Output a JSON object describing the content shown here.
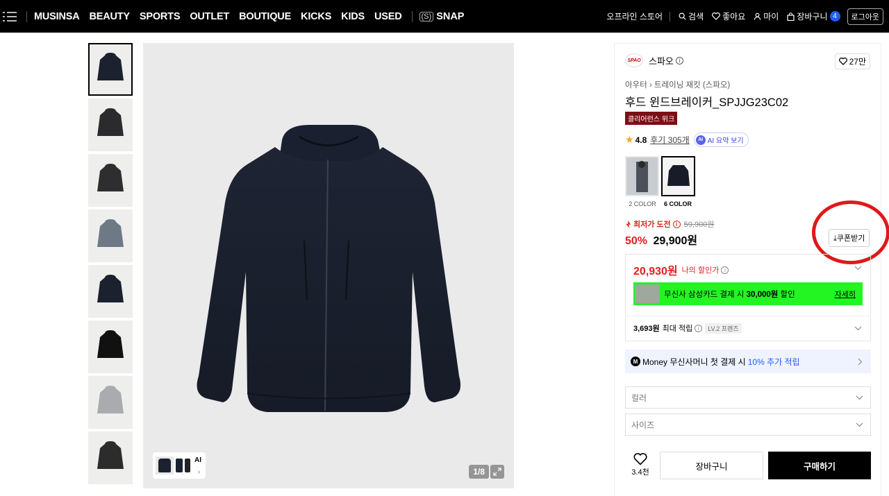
{
  "nav": {
    "links": [
      "MUSINSA",
      "BEAUTY",
      "SPORTS",
      "OUTLET",
      "BOUTIQUE",
      "KICKS",
      "KIDS",
      "USED"
    ],
    "snap_icon": "(S)",
    "snap": "SNAP",
    "offline": "오프라인 스토어",
    "search": "검색",
    "likes": "좋아요",
    "my": "마이",
    "cart": "장바구니",
    "cart_count": "4",
    "logout": "로그아웃"
  },
  "gallery": {
    "thumb_count": 8,
    "counter": "1/8",
    "mini_ai": "AI",
    "mini_arrow": "›"
  },
  "product": {
    "brand_logo": "SPAO",
    "brand": "스파오",
    "likes": "27만",
    "breadcrumb": "아우터 › 트레이닝 재킷 (스파오)",
    "title": "후드 윈드브레이커_SPJJG23C02",
    "badge": "클리어런스 위크",
    "rating": "4.8",
    "reviews": "후기 305개",
    "ai_summary": "AI 요약 보기",
    "ai_icon": "AI",
    "colors": [
      {
        "label": "2 COLOR",
        "selected": false
      },
      {
        "label": "6 COLOR",
        "selected": true
      }
    ],
    "lowest_label": "최저가 도전",
    "original_price": "59,900원",
    "discount_pct": "50%",
    "price": "29,900원",
    "coupon": "쿠폰받기",
    "my_price": "20,930원",
    "my_price_label": "나의 할인가",
    "card_text_pre": "무신사 삼성카드 결제 시 ",
    "card_amount": "30,000원",
    "card_text_post": " 할인",
    "card_detail": "자세히",
    "points_amount": "3,693원",
    "points_label": "최대 적립",
    "level": "LV.2 프렌즈",
    "money_icon": "M",
    "money_pre": "Money 무신사머니 첫 결제 시",
    "money_highlight": "10% 추가 적립",
    "color_select": "컬러",
    "size_select": "사이즈",
    "wish_count": "3.4천",
    "cart_btn": "장바구니",
    "buy_btn": "구매하기"
  }
}
